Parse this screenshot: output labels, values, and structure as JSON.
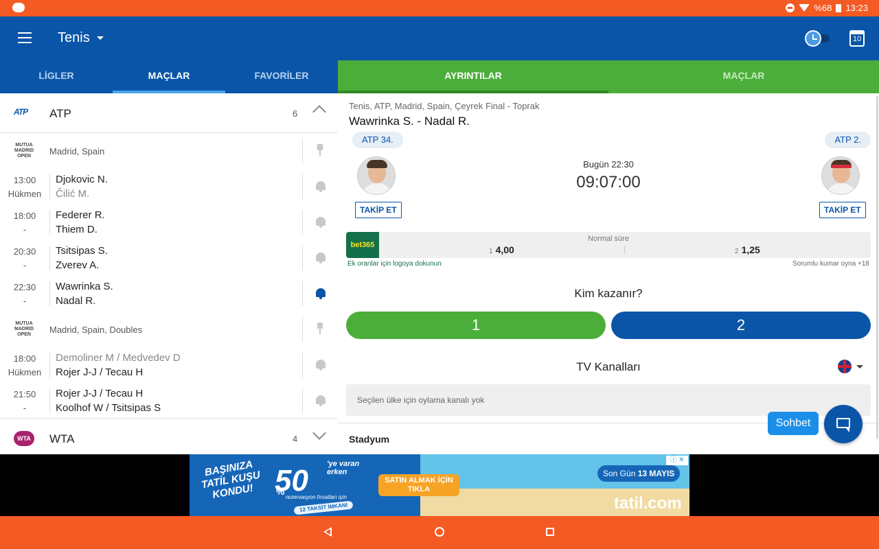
{
  "status_bar": {
    "battery": "%68",
    "time": "13:23"
  },
  "app_bar": {
    "sport": "Tenis",
    "calendar_day": "10"
  },
  "left_tabs": [
    "LİGLER",
    "MAÇLAR",
    "FAVORİLER"
  ],
  "right_tabs": [
    "AYRINTILAR",
    "MAÇLAR"
  ],
  "leagues": [
    {
      "logo": "ATP",
      "name": "ATP",
      "count": "6",
      "tournaments": [
        {
          "logo": "MUTUA MADRID OPEN",
          "name": "Madrid, Spain",
          "matches": [
            {
              "time": "13:00",
              "status": "Hükmen",
              "p1": "Djokovic N.",
              "p2": "Čilić M."
            },
            {
              "time": "18:00",
              "status": "-",
              "p1": "Federer R.",
              "p2": "Thiem D."
            },
            {
              "time": "20:30",
              "status": "-",
              "p1": "Tsitsipas S.",
              "p2": "Zverev A."
            },
            {
              "time": "22:30",
              "status": "-",
              "p1": "Wawrinka S.",
              "p2": "Nadal R."
            }
          ]
        },
        {
          "logo": "MUTUA MADRID OPEN",
          "name": "Madrid, Spain, Doubles",
          "matches": [
            {
              "time": "18:00",
              "status": "Hükmen",
              "p1": "Demoliner M / Medvedev D",
              "p2": "Rojer J-J / Tecau H"
            },
            {
              "time": "21:50",
              "status": "-",
              "p1": "Rojer J-J / Tecau H",
              "p2": "Koolhof W / Tsitsipas S"
            }
          ]
        }
      ]
    },
    {
      "logo": "WTA",
      "name": "WTA",
      "count": "4"
    }
  ],
  "detail": {
    "breadcrumb": "Tenis, ATP, Madrid, Spain, Çeyrek Final - Toprak",
    "title": "Wawrinka S. - Nadal R.",
    "home_rank": "ATP 34.",
    "away_rank": "ATP 2.",
    "follow_label": "TAKİP ET",
    "kickoff_date": "Bugün 22:30",
    "countdown": "09:07:00",
    "odds": {
      "bookmaker": "bet365",
      "label": "Normal süre",
      "home_key": "1",
      "home": "4,00",
      "away_key": "2",
      "away": "1,25",
      "hint": "Ek oranlar için logoya dokunun",
      "responsible": "Sorumlu kumar oyna +18",
      "brand_color": "#13704a"
    },
    "who_wins": "Kim kazanır?",
    "vote_home": "1",
    "vote_away": "2",
    "vote_home_color": "#4cae3a",
    "vote_away_color": "#0a55a8",
    "tv_title": "TV Kanalları",
    "tv_empty": "Seçilen ülke için oylama kanalı yok",
    "stadium_label": "Stadyum"
  },
  "chat": {
    "label": "Sohbet"
  },
  "ad": {
    "headline": "BAŞINIZA TATİL KUŞU KONDU!",
    "percent": "50",
    "percent_sign": "%",
    "percent_suffix": "'ye varan erken",
    "sub": "rezervasyon fırsatları için",
    "tag": "12 TAKSİT İMKANI",
    "cta": "SATIN ALMAK İÇİN TIKLA",
    "last_day": "Son Gün",
    "last_day_date": "13 MAYIS",
    "brand": "tatil.com"
  },
  "colors": {
    "status_bar": "#f45a23",
    "app_bar": "#0a55a8",
    "right_tabs": "#4cae3a"
  }
}
